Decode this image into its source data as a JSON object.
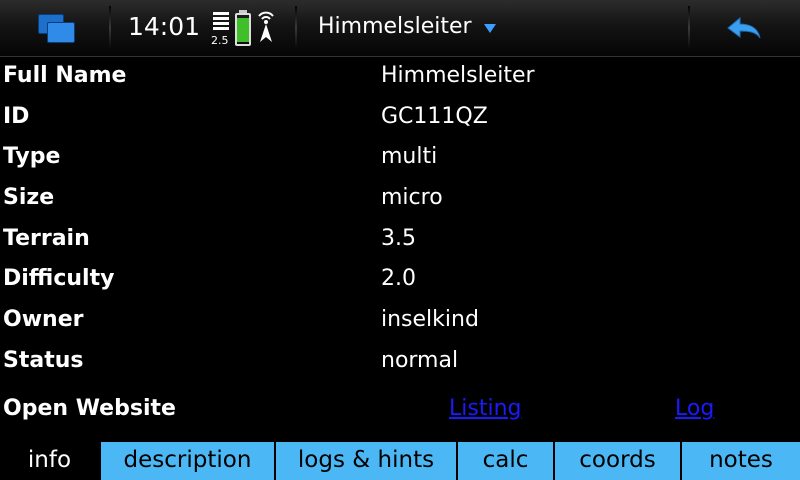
{
  "status_bar": {
    "time": "14:01",
    "network_type": "2.5",
    "title": "Himmelsleiter"
  },
  "details": [
    {
      "label": "Full Name",
      "value": "Himmelsleiter"
    },
    {
      "label": "ID",
      "value": "GC111QZ"
    },
    {
      "label": "Type",
      "value": "multi"
    },
    {
      "label": "Size",
      "value": "micro"
    },
    {
      "label": "Terrain",
      "value": "3.5"
    },
    {
      "label": "Difficulty",
      "value": "2.0"
    },
    {
      "label": "Owner",
      "value": "inselkind"
    },
    {
      "label": "Status",
      "value": "normal"
    }
  ],
  "website": {
    "label": "Open Website",
    "listing_link": "Listing",
    "log_link": "Log"
  },
  "tabs": [
    {
      "label": "info",
      "active": true
    },
    {
      "label": "description",
      "active": false
    },
    {
      "label": "logs & hints",
      "active": false
    },
    {
      "label": "calc",
      "active": false
    },
    {
      "label": "coords",
      "active": false
    },
    {
      "label": "notes",
      "active": false
    }
  ],
  "colors": {
    "tab_background": "#4bb8f5",
    "link": "#1a1aff",
    "battery": "#3fbf2a",
    "accent": "#3aa0ff"
  },
  "icons": {
    "switcher": "task-switcher-icon",
    "signal": "signal-strength-icon",
    "battery": "battery-icon",
    "gps": "gps-icon",
    "back": "back-arrow-icon",
    "caret": "dropdown-caret-icon"
  }
}
